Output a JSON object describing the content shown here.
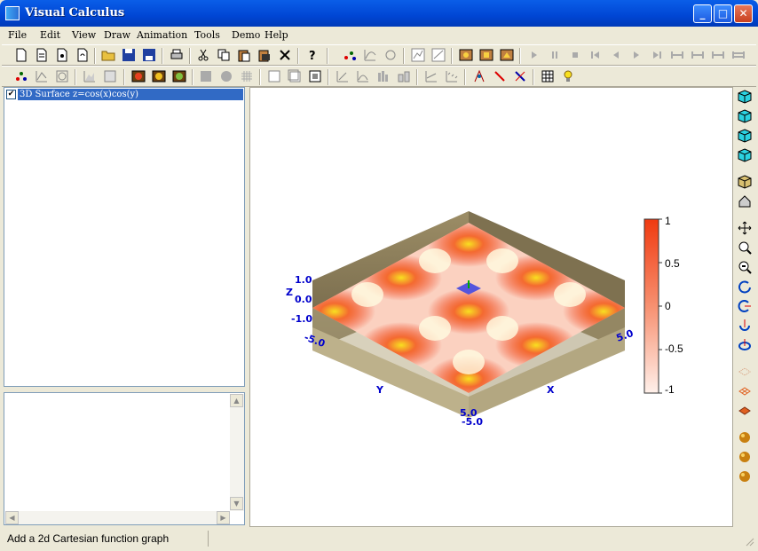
{
  "window": {
    "title": "Visual Calculus"
  },
  "menu": [
    "File",
    "Edit",
    "View",
    "Draw",
    "Animation",
    "Tools",
    "Demo",
    "Help"
  ],
  "tree": {
    "item_label": "3D Surface  z=cos(x)cos(y)",
    "checked": true
  },
  "status": {
    "text": "Add a 2d Cartesian function graph"
  },
  "plot": {
    "surface_function": "z=cos(x)cos(y)",
    "axes": {
      "x_label": "X",
      "y_label": "Y",
      "z_label": "Z",
      "z_ticks": [
        "1.0",
        "0.0",
        "-1.0"
      ],
      "x_ticks": [
        "-5.0",
        "5.0"
      ],
      "y_ticks": [
        "-5.0",
        "5.0"
      ],
      "x_range": [
        -5.0,
        5.0
      ],
      "y_range": [
        -5.0,
        5.0
      ],
      "z_range": [
        -1.0,
        1.0
      ]
    },
    "colorbar": {
      "ticks": [
        "1",
        "0.5",
        "0",
        "-0.5",
        "-1"
      ],
      "high_color": "#f03a10",
      "low_color": "#fff0ea"
    },
    "box_color": "#8b7d5a"
  }
}
